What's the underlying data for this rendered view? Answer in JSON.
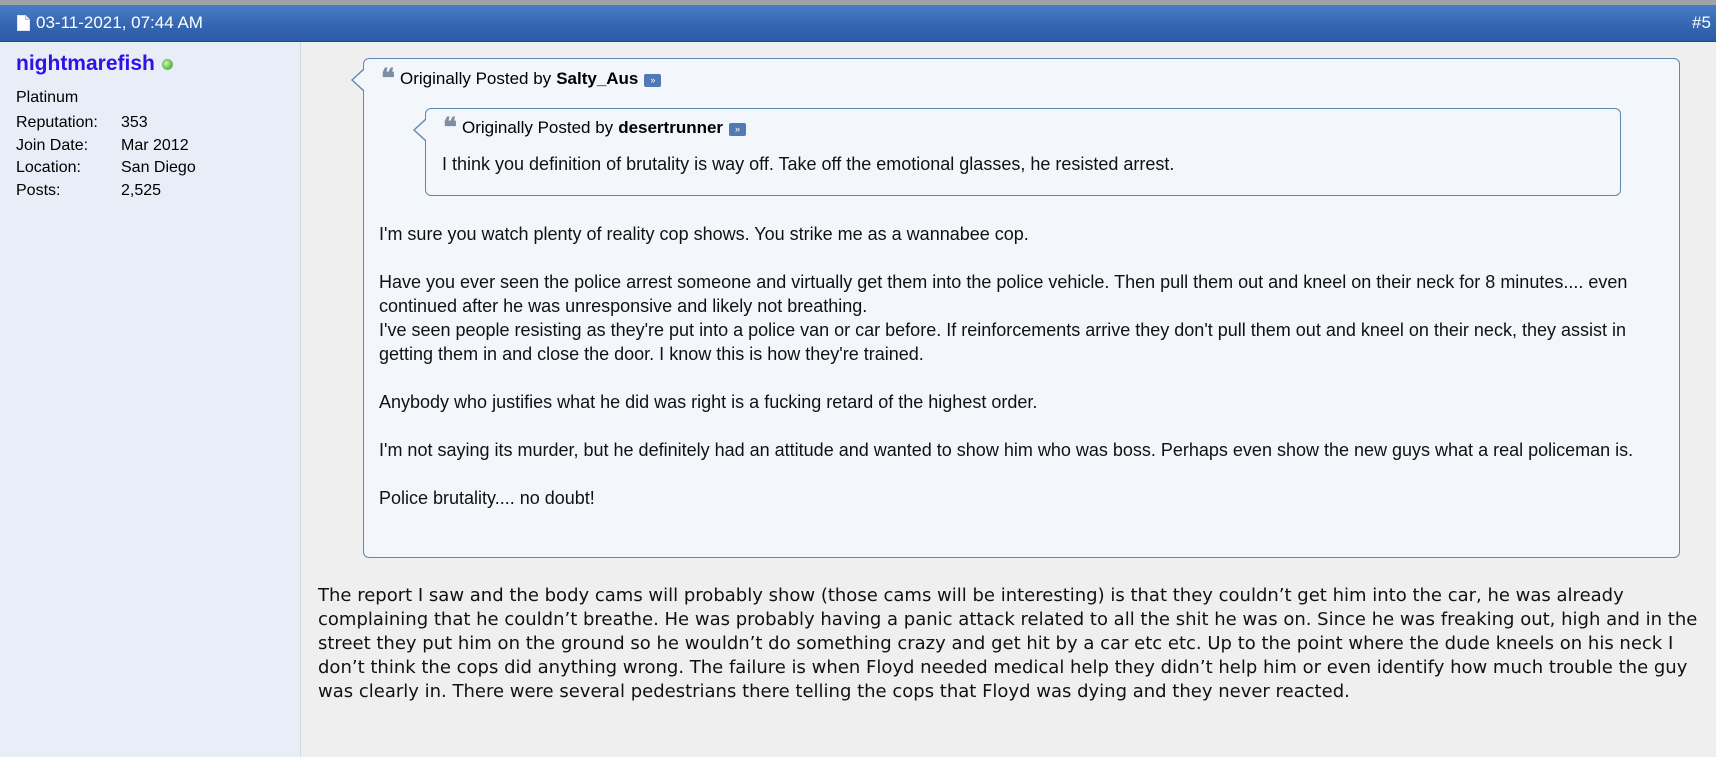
{
  "post": {
    "date": "03-11-2021, 07:44 AM",
    "number": "#5",
    "icons": {
      "header": "document-icon",
      "online": "online-status-dot-icon",
      "quote": "quote-marks-icon",
      "view_post": "view-post-arrow-icon"
    }
  },
  "user": {
    "name": "nightmarefish",
    "title": "Platinum",
    "info": [
      {
        "label": "Reputation:",
        "value": "353"
      },
      {
        "label": "Join Date:",
        "value": "Mar 2012"
      },
      {
        "label": "Location:",
        "value": "San Diego"
      },
      {
        "label": "Posts:",
        "value": "2,525"
      }
    ]
  },
  "outer_quote": {
    "prefix": "Originally Posted by",
    "author": "Salty_Aus",
    "paragraphs": [
      "I'm sure you watch plenty of reality cop shows. You strike me as a wannabee cop.",
      "Have you ever seen the police arrest someone and virtually get them into the police vehicle. Then pull them out and kneel on their neck for 8 minutes.... even continued after he was unresponsive and likely not breathing.\nI've seen people resisting as they're put into a police van or car before. If reinforcements arrive they don't pull them out and kneel on their neck, they assist in getting them in and close the door. I know this is how they're trained.",
      "Anybody who justifies what he did was right is a fucking retard of the highest order.",
      "I'm not saying its murder, but he definitely had an attitude and wanted to show him who was boss. Perhaps even show the new guys what a real policeman is.",
      "Police brutality.... no doubt!"
    ]
  },
  "inner_quote": {
    "prefix": "Originally Posted by",
    "author": "desertrunner",
    "text": "I think you definition of brutality is way off. Take off the emotional glasses, he resisted arrest."
  },
  "reply": {
    "text": "The report I saw and the body cams will probably show (those cams will be interesting) is that they couldn’t get him into the car, he was already complaining that he couldn’t breathe. He was probably having a panic attack related to all the shit he was on. Since he was freaking out, high and in the street they put him on the ground so he wouldn’t do something crazy and get hit by a car etc etc. Up to the point where the dude kneels on his neck I don’t think the cops did anything wrong. The failure is when Floyd needed medical help they didn’t help him or even identify how much trouble the guy was clearly in. There were several pedestrians there telling the cops that Floyd was dying and they never reacted."
  },
  "colors": {
    "header_bar": "#3466b2",
    "username": "#2f10e6",
    "quote_border": "#5f86b0",
    "sidebar": "#e8eef7"
  }
}
